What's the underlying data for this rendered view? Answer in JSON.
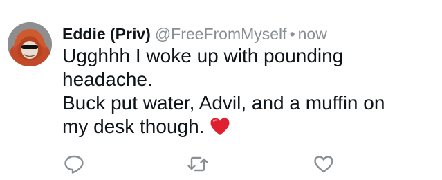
{
  "tweet": {
    "display_name": "Eddie (Priv)",
    "handle": "@FreeFromMyself",
    "separator": "•",
    "timestamp": "now",
    "text_lines": [
      "Ugghhh I woke up with pounding",
      "headache.",
      "Buck put water, Advil, and a muffin on",
      "my desk though."
    ],
    "emoji": "red-heart"
  },
  "actions": {
    "reply_icon": "speech-bubble-icon",
    "retweet_icon": "retweet-icon",
    "like_icon": "heart-outline-icon"
  },
  "colors": {
    "text": "#0f1419",
    "secondary_text": "#8a8f94",
    "icon_gray": "#8a8f94",
    "heart_red": "#e0202e"
  }
}
